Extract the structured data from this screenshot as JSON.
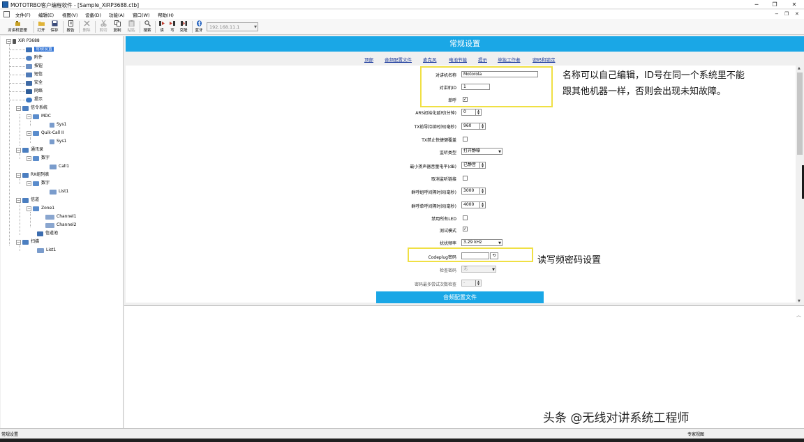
{
  "window": {
    "title": "MOTOTRBO客户编程软件 - [Sample_XiRP3688.ctb]",
    "minimize": "─",
    "restore": "❐",
    "close": "✕"
  },
  "menu": {
    "items": [
      "文件(F)",
      "编辑(E)",
      "视图(V)",
      "设备(D)",
      "功能(A)",
      "窗口(W)",
      "帮助(H)"
    ],
    "mdi_minimize": "−",
    "mdi_restore": "❐",
    "mdi_close": "✕"
  },
  "toolbar": {
    "buttons": [
      "对讲机管理",
      "打开",
      "保存",
      "报告",
      "删除",
      "剪切",
      "复制",
      "粘贴",
      "搜索",
      "读",
      "写",
      "克隆",
      "蓝牙"
    ],
    "ip_address": "192.168.11.1"
  },
  "tree": {
    "root": "XiR P3688",
    "general": "常规设置",
    "accessories": "附件",
    "buttons": "按钮",
    "text_msg": "短信",
    "security": "安全",
    "network": "网络",
    "alerts": "提示",
    "signaling": "信令系统",
    "mdc": "MDC",
    "sys1_a": "Sys1",
    "quickcall": "Quik-Call II",
    "sys1_b": "Sys1",
    "contacts": "通讯录",
    "digital_a": "数字",
    "call1": "Call1",
    "rx_group": "RX组列表",
    "digital_b": "数字",
    "list1_a": "List1",
    "channels": "信道",
    "zone1": "Zone1",
    "channel1": "Channel1",
    "channel2": "Channel2",
    "channel_pool": "信道池",
    "scan": "扫描",
    "list1_b": "List1"
  },
  "main": {
    "header": "常规设置",
    "nav_links": [
      "顶部",
      "音频配置文件",
      "麦克风",
      "电池节能",
      "提示",
      "单独工作者",
      "密码和锁定"
    ],
    "fields": {
      "radio_name_label": "对讲机名称",
      "radio_name_value": "Motorola",
      "radio_id_label": "对讲机ID",
      "radio_id_value": "1",
      "single_label": "单呼",
      "ars_label": "ARS初始化延时(分钟)",
      "ars_value": "0",
      "tx_preamble_label": "TX前导持续时间(毫秒)",
      "tx_preamble_value": "960",
      "tx_disable_label": "TX禁止快捷键覆盖",
      "monitor_type_label": "监听类型",
      "monitor_type_value": "打开静噪",
      "min_volume_label": "最小扬声器音量电平(dB)",
      "min_volume_value": "已静音",
      "cancel_monitor_label": "取消监听链接",
      "group_hang_label": "群呼组呼间隔时间(毫秒)",
      "group_hang_value": "3000",
      "private_hang_label": "群呼单呼间隔时间(毫秒)",
      "private_hang_value": "4000",
      "disable_led_label": "禁用所有LED",
      "test_mode_label": "测试模式",
      "freq_label": "扰扰频率",
      "freq_value": "3.29 kHz",
      "codeplug_pwd_label": "Codeplug密码",
      "check_pwd_label": "检查密码",
      "check_pwd_value": "无",
      "pwd_attempts_label": "密码最多尝试次数检查",
      "pwd_attempts_value": "-"
    },
    "annotation_name_line1": "名称可以自己编辑，ID号在同一个系统里不能",
    "annotation_name_line2": "跟其他机器一样，否则会出现未知故障。",
    "annotation_pwd": "读写频密码设置",
    "section_button": "音频配置文件"
  },
  "help_pane": {
    "watermark": "头条 @无线对讲系统工程师"
  },
  "status": {
    "left": "常规设置",
    "right": "专家视图"
  },
  "colors": {
    "accent_blue": "#1aa7e6",
    "highlight_yellow": "#f0e044",
    "selected_tree": "#3375d6",
    "link_blue": "#1a3a9c"
  }
}
